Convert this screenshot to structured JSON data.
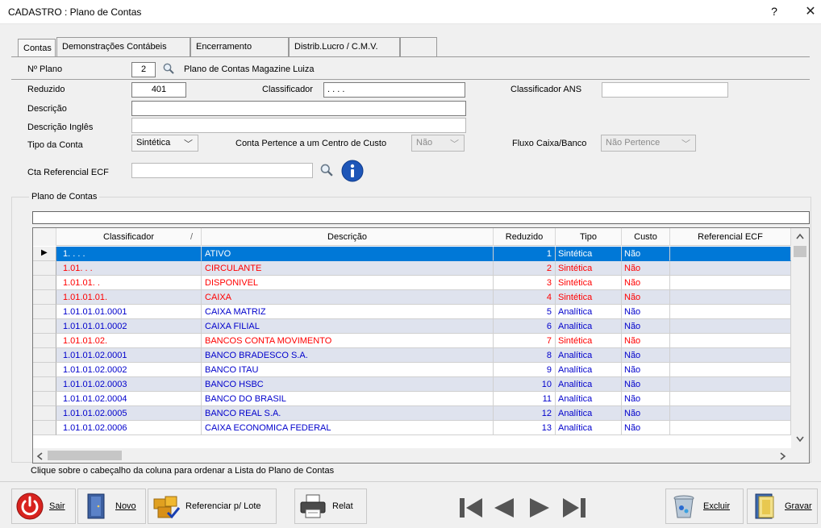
{
  "window": {
    "title": "CADASTRO : Plano de Contas",
    "help": "?",
    "close": "✕"
  },
  "tabs": [
    "Contas",
    "Demonstrações Contábeis",
    "Encerramento",
    "Distrib.Lucro / C.M.V.",
    ""
  ],
  "plano": {
    "label": "Nº Plano",
    "number": "2",
    "name": "Plano de Contas Magazine Luiza"
  },
  "form": {
    "reduzido_label": "Reduzido",
    "reduzido": "401",
    "classificador_label": "Classificador",
    "classificador": ". . . .",
    "classificador_ans_label": "Classificador ANS",
    "classificador_ans": "",
    "descricao_label": "Descrição",
    "descricao": "",
    "descricao_ingles_label": "Descrição Inglês",
    "descricao_ingles": "",
    "tipo_label": "Tipo da Conta",
    "tipo": "Sintética",
    "centro_custo_label": "Conta Pertence a um Centro de Custo",
    "centro_custo": "Não",
    "fluxo_label": "Fluxo Caixa/Banco",
    "fluxo": "Não Pertence",
    "cta_ref_label": "Cta Referencial ECF",
    "cta_ref": ""
  },
  "grid": {
    "group_label": "Plano de Contas",
    "columns": [
      "Classificador",
      "Descrição",
      "Reduzido",
      "Tipo",
      "Custo",
      "Referencial ECF"
    ],
    "sort_glyph": "/",
    "current_row_marker": "▶",
    "rows": [
      {
        "classificador": "1.    .    .    .",
        "descricao": "ATIVO",
        "reduzido": "1",
        "tipo": "Sintética",
        "custo": "Não",
        "ref": "",
        "kind": "selected"
      },
      {
        "classificador": "1.01.    .    .",
        "descricao": "CIRCULANTE",
        "reduzido": "2",
        "tipo": "Sintética",
        "custo": "Não",
        "ref": "",
        "kind": "synthetic"
      },
      {
        "classificador": "1.01.01.    .",
        "descricao": "DISPONIVEL",
        "reduzido": "3",
        "tipo": "Sintética",
        "custo": "Não",
        "ref": "",
        "kind": "synthetic"
      },
      {
        "classificador": "1.01.01.01.",
        "descricao": "CAIXA",
        "reduzido": "4",
        "tipo": "Sintética",
        "custo": "Não",
        "ref": "",
        "kind": "synthetic"
      },
      {
        "classificador": "1.01.01.01.0001",
        "descricao": "CAIXA MATRIZ",
        "reduzido": "5",
        "tipo": "Analítica",
        "custo": "Não",
        "ref": "",
        "kind": "analytic"
      },
      {
        "classificador": "1.01.01.01.0002",
        "descricao": "CAIXA FILIAL",
        "reduzido": "6",
        "tipo": "Analítica",
        "custo": "Não",
        "ref": "",
        "kind": "analytic"
      },
      {
        "classificador": "1.01.01.02.",
        "descricao": "BANCOS CONTA MOVIMENTO",
        "reduzido": "7",
        "tipo": "Sintética",
        "custo": "Não",
        "ref": "",
        "kind": "synthetic"
      },
      {
        "classificador": "1.01.01.02.0001",
        "descricao": "BANCO BRADESCO S.A.",
        "reduzido": "8",
        "tipo": "Analítica",
        "custo": "Não",
        "ref": "",
        "kind": "analytic"
      },
      {
        "classificador": "1.01.01.02.0002",
        "descricao": "BANCO ITAU",
        "reduzido": "9",
        "tipo": "Analítica",
        "custo": "Não",
        "ref": "",
        "kind": "analytic"
      },
      {
        "classificador": "1.01.01.02.0003",
        "descricao": "BANCO HSBC",
        "reduzido": "10",
        "tipo": "Analítica",
        "custo": "Não",
        "ref": "",
        "kind": "analytic"
      },
      {
        "classificador": "1.01.01.02.0004",
        "descricao": "BANCO DO BRASIL",
        "reduzido": "11",
        "tipo": "Analítica",
        "custo": "Não",
        "ref": "",
        "kind": "analytic"
      },
      {
        "classificador": "1.01.01.02.0005",
        "descricao": "BANCO REAL S.A.",
        "reduzido": "12",
        "tipo": "Analítica",
        "custo": "Não",
        "ref": "",
        "kind": "analytic"
      },
      {
        "classificador": "1.01.01.02.0006",
        "descricao": "CAIXA ECONOMICA FEDERAL",
        "reduzido": "13",
        "tipo": "Analítica",
        "custo": "Não",
        "ref": "",
        "kind": "analytic"
      }
    ]
  },
  "hint": "Clique sobre o cabeçalho da coluna para ordenar a Lista do Plano de Contas",
  "buttons": {
    "sair": "Sair",
    "novo": "Novo",
    "referenciar": "Referenciar p/ Lote",
    "relat": "Relat",
    "excluir": "Excluir",
    "gravar": "Gravar"
  },
  "icons": [
    "search-icon",
    "info-icon",
    "power-icon",
    "door-icon",
    "boxes-check-icon",
    "printer-icon",
    "first-record-icon",
    "previous-record-icon",
    "next-record-icon",
    "last-record-icon",
    "trash-icon",
    "save-icon"
  ],
  "colors": {
    "selected_bg": "#0078d7",
    "synthetic_text": "#ff0000",
    "analytic_text": "#0000cc",
    "row_alt_bg": "#dfe3ee",
    "row_bg": "#ffffff"
  }
}
